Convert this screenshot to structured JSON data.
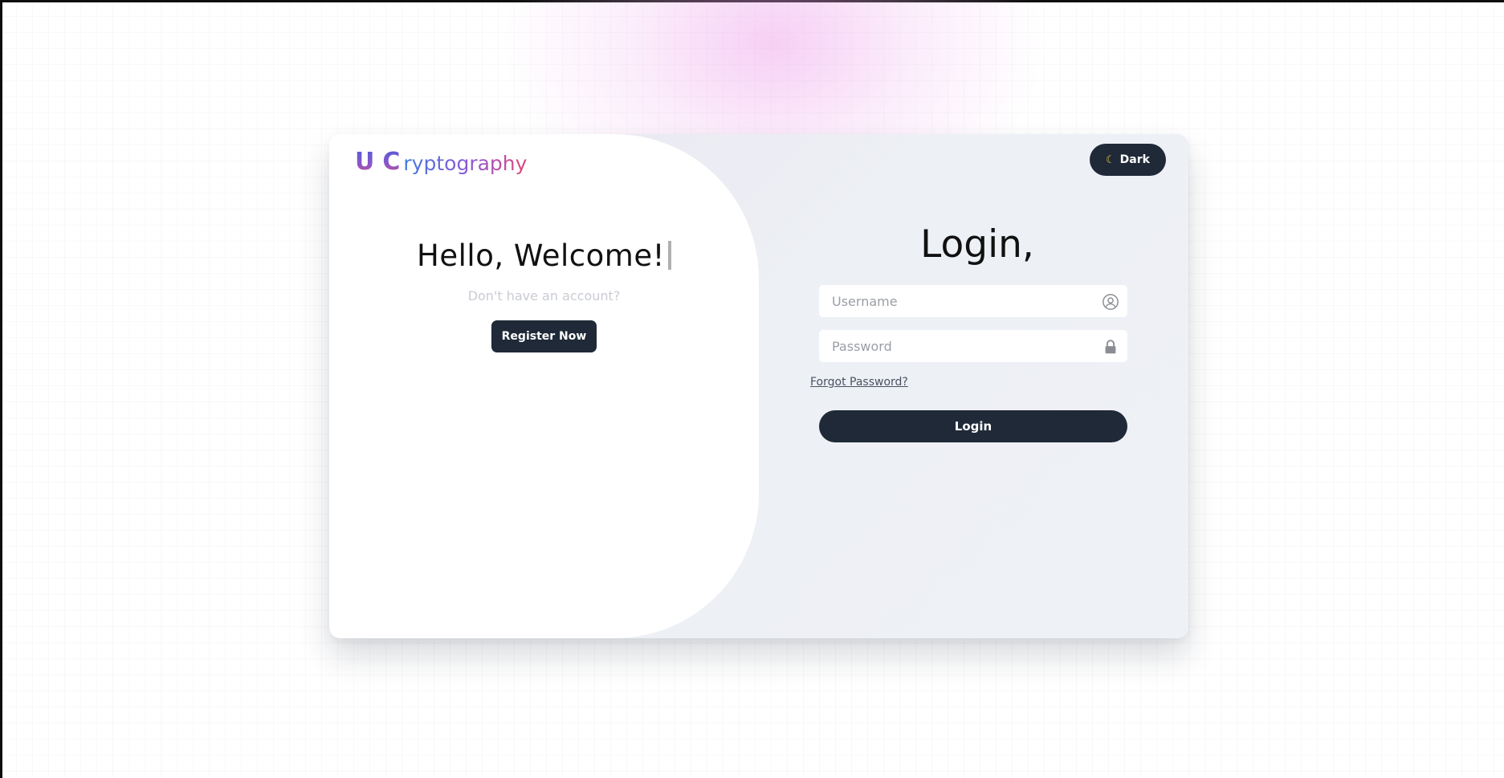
{
  "brand": {
    "logo_u": "U",
    "logo_c": "C",
    "logo_rest": "ryptography"
  },
  "theme_toggle": {
    "icon": "moon-icon",
    "label": "Dark"
  },
  "welcome": {
    "heading": "Hello, Welcome!",
    "subtext": "Don't have an account?",
    "register_label": "Register Now"
  },
  "login": {
    "title": "Login,",
    "username_placeholder": "Username",
    "username_icon": "user-circle-icon",
    "password_placeholder": "Password",
    "password_icon": "lock-icon",
    "forgot_label": "Forgot Password?",
    "submit_label": "Login"
  },
  "colors": {
    "primary_button": "#1f2937",
    "accent_moon": "#f2c94c",
    "logo_gradient_start": "#3f7be0",
    "logo_gradient_end": "#e0477a"
  }
}
